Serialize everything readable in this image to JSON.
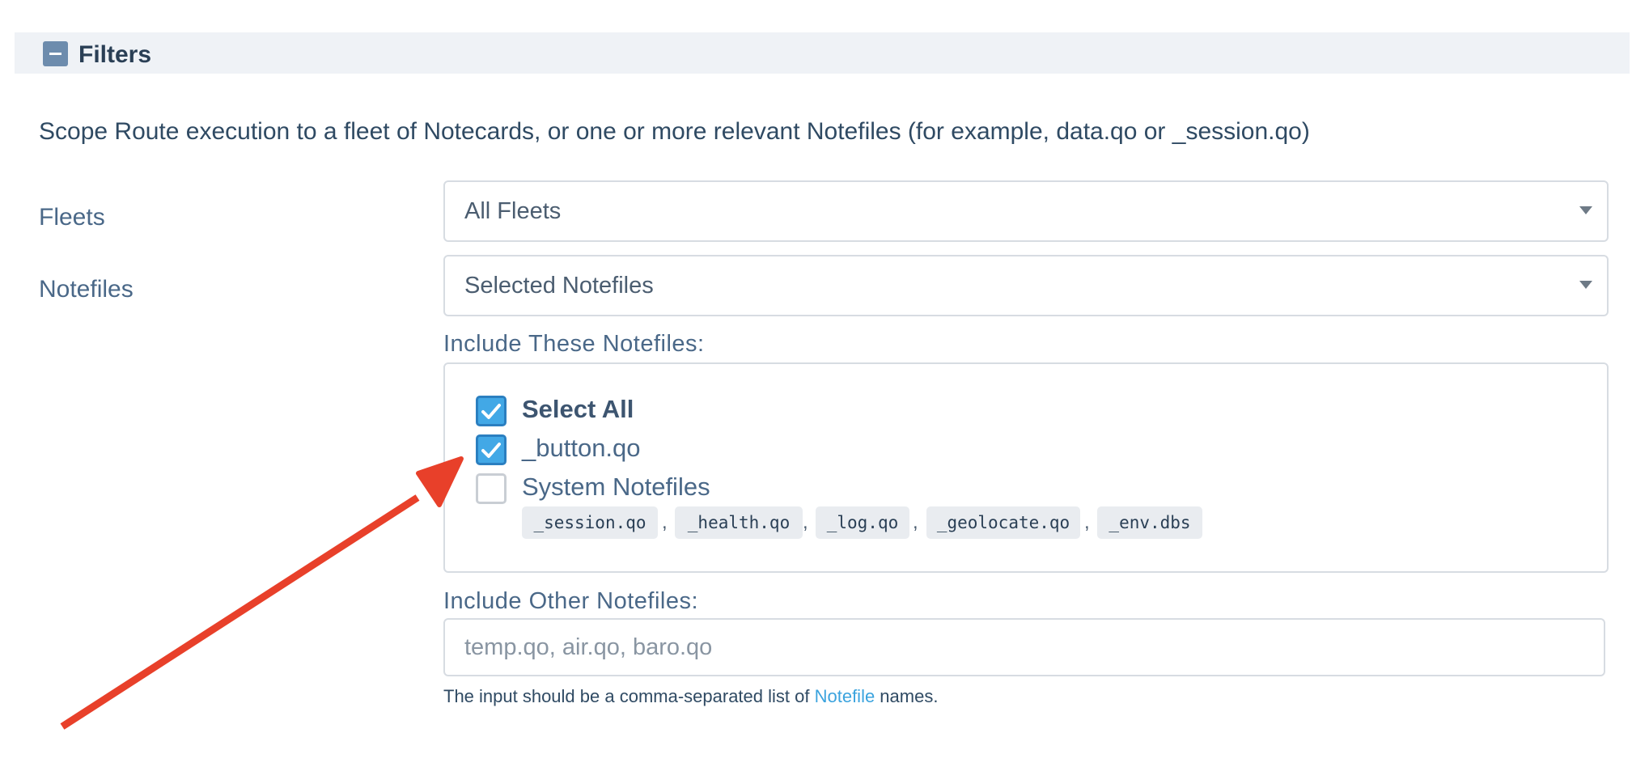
{
  "header": {
    "title": "Filters",
    "collapse_icon": "minus-square-icon"
  },
  "description": "Scope Route execution to a fleet of Notecards, or one or more relevant Notefiles (for example, data.qo or _session.qo)",
  "fleets": {
    "label": "Fleets",
    "selected": "All Fleets"
  },
  "notefiles": {
    "label": "Notefiles",
    "selected": "Selected Notefiles"
  },
  "include_these": {
    "label": "Include These Notefiles:",
    "items": [
      {
        "label": "Select All",
        "checked": true
      },
      {
        "label": "_button.qo",
        "checked": true
      },
      {
        "label": "System Notefiles",
        "checked": false
      }
    ],
    "system_notefiles": [
      "_session.qo",
      "_health.qo",
      "_log.qo",
      "_geolocate.qo",
      "_env.dbs"
    ],
    "separator": ","
  },
  "include_other": {
    "label": "Include Other Notefiles:",
    "placeholder": "temp.qo, air.qo, baro.qo",
    "help_prefix": "The input should be a comma-separated list of ",
    "help_link": "Notefile",
    "help_suffix": " names."
  },
  "colors": {
    "accent": "#42a8e6",
    "arrow": "#e8402a",
    "header_bg": "#eff2f6"
  }
}
